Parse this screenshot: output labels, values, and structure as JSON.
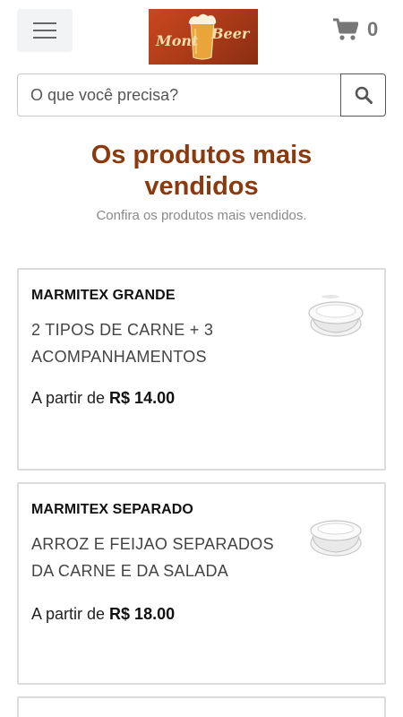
{
  "header": {
    "menu_icon": "hamburger-menu-icon",
    "logo_text": "MontBeer",
    "cart_icon": "shopping-cart-icon",
    "cart_count": "0"
  },
  "search": {
    "placeholder": "O que você precisa?",
    "value": "",
    "icon": "search-icon"
  },
  "section": {
    "title_line1": "Os produtos mais",
    "title_line2": "vendidos",
    "subtitle": "Confira os produtos mais vendidos."
  },
  "products": [
    {
      "name": "MARMITEX GRANDE",
      "desc_line1": "2 TIPOS DE CARNE + 3",
      "desc_line2": "ACOMPANHAMENTOS",
      "price_prefix": "A partir de",
      "price": "R$ 14.00",
      "image_icon": "takeout-container-icon"
    },
    {
      "name": "MARMITEX SEPARADO",
      "desc_line1": "ARROZ E FEIJAO SEPARADOS",
      "desc_line2": "DA CARNE E DA SALADA",
      "price_prefix": "A partir de",
      "price": "R$ 18.00",
      "image_icon": "takeout-container-icon"
    }
  ],
  "colors": {
    "accent_title": "#8b3a0f",
    "logo_bg": "#c9471f",
    "logo_text": "#f6dca8"
  }
}
